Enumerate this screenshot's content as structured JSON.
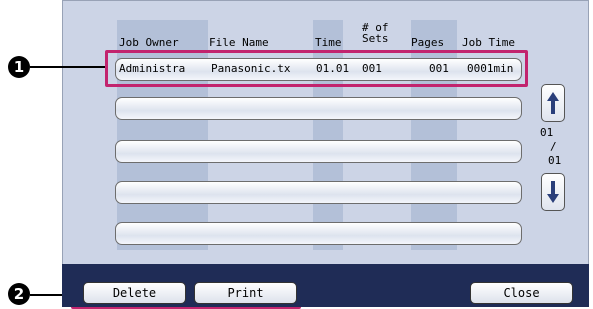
{
  "header": {
    "job_owner": "Job Owner",
    "file_name": "File Name",
    "time": "Time",
    "sets_line1": "# of",
    "sets_line2": "Sets",
    "pages": "Pages",
    "job_time": "Job Time"
  },
  "jobs": [
    {
      "owner": "Administra",
      "file": "Panasonic.tx",
      "time": "01.01",
      "sets": "001",
      "pages": "001",
      "job_time": "0001min"
    }
  ],
  "pager": {
    "current": "01",
    "separator": "/",
    "total": "01"
  },
  "buttons": {
    "delete": "Delete",
    "print": "Print",
    "close": "Close"
  },
  "callouts": {
    "one": "1",
    "two": "2"
  },
  "colors": {
    "highlight": "#c2246e",
    "bar": "#1f2c56",
    "screen": "#ccd4e6"
  },
  "icons": {
    "scroll_up": "arrow-up-icon",
    "scroll_down": "arrow-down-icon"
  }
}
